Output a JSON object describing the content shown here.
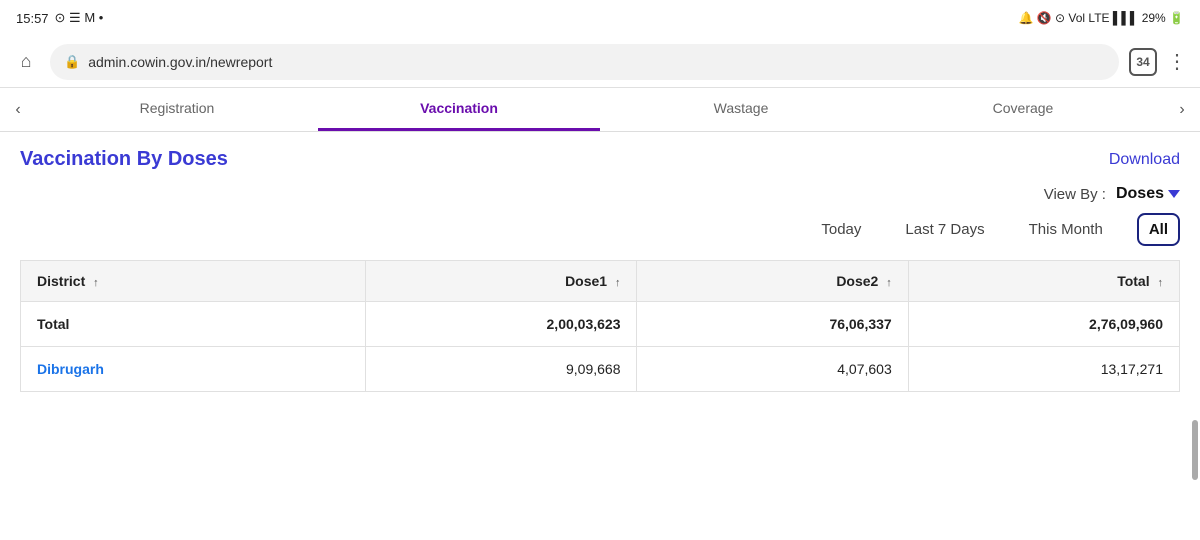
{
  "statusBar": {
    "time": "15:57",
    "icons": "⊙ ☰ M •",
    "right": "🔔 🔇 ⊙ Vol LTE 29%"
  },
  "urlBar": {
    "url": "admin.cowin.gov.in/newreport",
    "tabCount": "34"
  },
  "navTabs": {
    "items": [
      {
        "label": "Registration",
        "active": false
      },
      {
        "label": "Vaccination",
        "active": true
      },
      {
        "label": "Wastage",
        "active": false
      },
      {
        "label": "Coverage",
        "active": false
      }
    ]
  },
  "section": {
    "title": "Vaccination By Doses",
    "downloadLabel": "Download"
  },
  "viewBy": {
    "label": "View By :",
    "value": "Doses"
  },
  "timeFilters": [
    {
      "label": "Today",
      "active": false
    },
    {
      "label": "Last 7 Days",
      "active": false
    },
    {
      "label": "This Month",
      "active": false
    },
    {
      "label": "All",
      "active": true
    }
  ],
  "table": {
    "headers": [
      {
        "label": "District",
        "sort": "↑"
      },
      {
        "label": "Dose1",
        "sort": "↑"
      },
      {
        "label": "Dose2",
        "sort": "↑"
      },
      {
        "label": "Total",
        "sort": "↑"
      }
    ],
    "rows": [
      {
        "district": "Total",
        "dose1": "2,00,03,623",
        "dose2": "76,06,337",
        "total": "2,76,09,960",
        "isBold": true
      },
      {
        "district": "Dibrugarh",
        "dose1": "9,09,668",
        "dose2": "4,07,603",
        "total": "13,17,271",
        "isBold": false
      }
    ]
  }
}
